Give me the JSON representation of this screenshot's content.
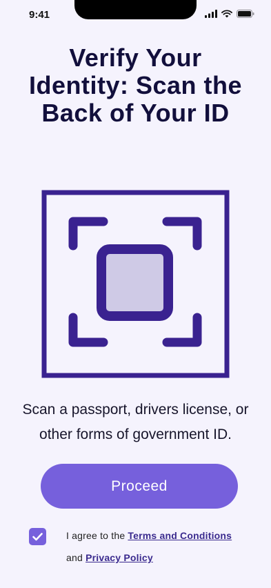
{
  "status": {
    "time": "9:41",
    "icons": [
      "cellular-signal-icon",
      "wifi-icon",
      "battery-icon"
    ]
  },
  "title": "Verify Your Identity: Scan the Back of Your ID",
  "description": "Scan a passport, drivers license, or other forms of government ID.",
  "proceed_label": "Proceed",
  "consent": {
    "checked": true,
    "prefix": "I agree to the ",
    "terms_link": "Terms and Conditions",
    "connector": "and ",
    "privacy_link": "Privacy Policy"
  },
  "colors": {
    "background": "#f5f3fd",
    "primary": "#7660dc",
    "icon_stroke": "#3a2290",
    "icon_fill": "#cfcae6",
    "title": "#120f3c"
  }
}
